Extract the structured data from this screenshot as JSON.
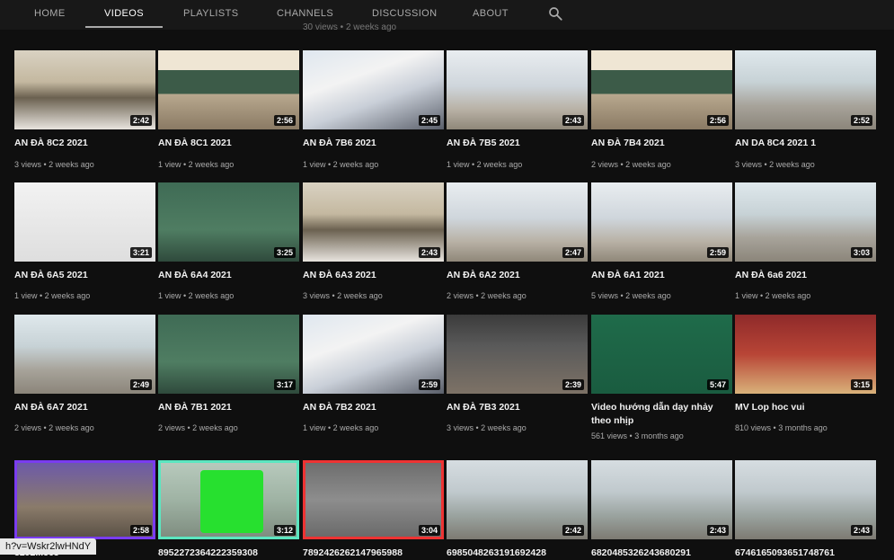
{
  "tabs": [
    {
      "label": "HOME"
    },
    {
      "label": "VIDEOS"
    },
    {
      "label": "PLAYLISTS"
    },
    {
      "label": "CHANNELS"
    },
    {
      "label": "DISCUSSION"
    },
    {
      "label": "ABOUT"
    }
  ],
  "partial_meta": "30 views • 2 weeks ago",
  "videos": [
    {
      "title": "AN ĐÀ 8C2 2021",
      "duration": "2:42",
      "views": "3 views",
      "age": "2 weeks ago",
      "scene": "classroom"
    },
    {
      "title": "AN ĐÀ 8C1 2021",
      "duration": "2:56",
      "views": "1 view",
      "age": "2 weeks ago",
      "scene": "board"
    },
    {
      "title": "AN ĐÀ 7B6 2021",
      "duration": "2:45",
      "views": "1 view",
      "age": "2 weeks ago",
      "scene": "kids"
    },
    {
      "title": "AN ĐÀ 7B5 2021",
      "duration": "2:43",
      "views": "1 view",
      "age": "2 weeks ago",
      "scene": "hall"
    },
    {
      "title": "AN ĐÀ 7B4 2021",
      "duration": "2:56",
      "views": "2 views",
      "age": "2 weeks ago",
      "scene": "board"
    },
    {
      "title": "AN DA 8C4 2021 1",
      "duration": "2:52",
      "views": "3 views",
      "age": "2 weeks ago",
      "scene": "yard"
    },
    {
      "title": "AN ĐÀ 6A5 2021",
      "duration": "3:21",
      "views": "1 view",
      "age": "2 weeks ago",
      "scene": "washed"
    },
    {
      "title": "AN ĐÀ 6A4 2021",
      "duration": "3:25",
      "views": "1 view",
      "age": "2 weeks ago",
      "scene": "greenboard"
    },
    {
      "title": "AN ĐÀ 6A3 2021",
      "duration": "2:43",
      "views": "3 views",
      "age": "2 weeks ago",
      "scene": "classroom"
    },
    {
      "title": "AN ĐÀ 6A2 2021",
      "duration": "2:47",
      "views": "2 views",
      "age": "2 weeks ago",
      "scene": "hall"
    },
    {
      "title": "AN ĐÀ 6A1 2021",
      "duration": "2:59",
      "views": "5 views",
      "age": "2 weeks ago",
      "scene": "hall"
    },
    {
      "title": "AN ĐÀ 6a6 2021",
      "duration": "3:03",
      "views": "1 view",
      "age": "2 weeks ago",
      "scene": "yard"
    },
    {
      "title": "AN ĐÀ 6A7 2021",
      "duration": "2:49",
      "views": "2 views",
      "age": "2 weeks ago",
      "scene": "yard"
    },
    {
      "title": "AN ĐÀ 7B1 2021",
      "duration": "3:17",
      "views": "2 views",
      "age": "2 weeks ago",
      "scene": "greenboard"
    },
    {
      "title": "AN ĐÀ 7B2 2021",
      "duration": "2:59",
      "views": "1 view",
      "age": "2 weeks ago",
      "scene": "kids"
    },
    {
      "title": "AN ĐÀ 7B3 2021",
      "duration": "2:39",
      "views": "3 views",
      "age": "2 weeks ago",
      "scene": "dark"
    },
    {
      "title": "Video hướng dẫn dạy nhảy theo nhịp",
      "duration": "5:47",
      "views": "561 views",
      "age": "3 months ago",
      "scene": "green"
    },
    {
      "title": "MV Lop hoc vui",
      "duration": "3:15",
      "views": "810 views",
      "age": "3 months ago",
      "scene": "red"
    },
    {
      "title": "3292...563",
      "duration": "2:58",
      "scene": "purple"
    },
    {
      "title": "8952272364222359308",
      "duration": "3:12",
      "scene": "greenscreen"
    },
    {
      "title": "7892426262147965988",
      "duration": "3:04",
      "scene": "redframe"
    },
    {
      "title": "6985048263191692428",
      "duration": "2:42",
      "scene": "outdoor"
    },
    {
      "title": "6820485326243680291",
      "duration": "2:43",
      "scene": "outdoor"
    },
    {
      "title": "6746165093651748761",
      "duration": "2:43",
      "scene": "outdoor"
    }
  ],
  "status_url": "h?v=Wskr2lwHNdY",
  "colors": {
    "background": "#0f0f0f",
    "tabbar": "#181818",
    "meta": "#aaaaaa"
  }
}
